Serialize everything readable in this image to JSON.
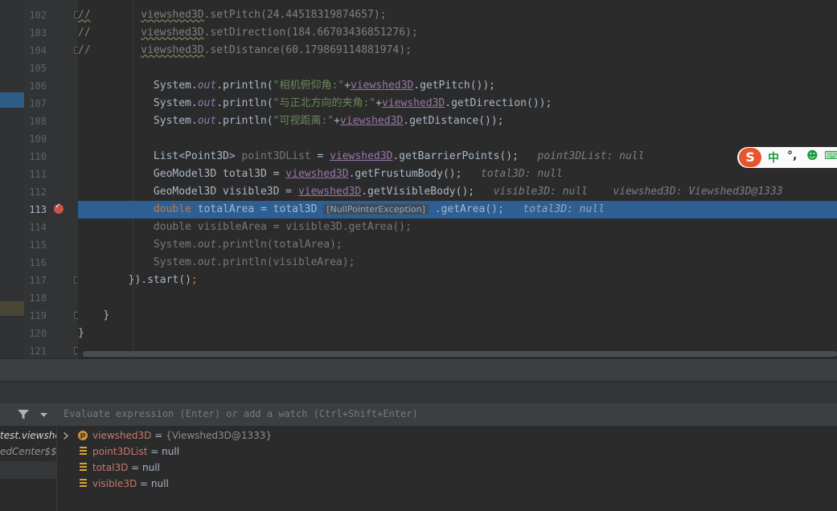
{
  "gutter": {
    "line_numbers": [
      "102",
      "103",
      "104",
      "105",
      "106",
      "107",
      "108",
      "109",
      "110",
      "111",
      "112",
      "113",
      "114",
      "115",
      "116",
      "117",
      "118",
      "119",
      "120",
      "121"
    ],
    "current_line": "113"
  },
  "code": {
    "l102": {
      "comment": "//",
      "obj": "viewshed3D",
      "rest": ".setPitch(24.44518319874657);"
    },
    "l103": {
      "comment": "//",
      "obj": "viewshed3D",
      "rest": ".setDirection(184.66703436851276);"
    },
    "l104": {
      "comment": "//",
      "obj": "viewshed3D",
      "rest": ".setDistance(60.179869114881974);"
    },
    "l106": {
      "a": "System.",
      "out": "out",
      "b": ".println(",
      "str": "\"相机俯仰角:\"",
      "plus": "+",
      "var": "viewshed3D",
      "rest": ".getPitch());"
    },
    "l107": {
      "a": "System.",
      "out": "out",
      "b": ".println(",
      "str": "\"与正北方向的夹角:\"",
      "plus": "+",
      "var": "viewshed3D",
      "rest": ".getDirection());"
    },
    "l108": {
      "a": "System.",
      "out": "out",
      "b": ".println(",
      "str": "\"可视距离:\"",
      "plus": "+",
      "var": "viewshed3D",
      "rest": ".getDistance());"
    },
    "l110": {
      "a": "List<Point3D> ",
      "name": "point3DList",
      "eq": " = ",
      "var": "viewshed3D",
      "rest": ".getBarrierPoints();",
      "inline": "point3DList: null"
    },
    "l111": {
      "a": "GeoModel3D total3D = ",
      "var": "viewshed3D",
      "rest": ".getFrustumBody();",
      "inline": "total3D: null"
    },
    "l112": {
      "a": "GeoModel3D visible3D = ",
      "var": "viewshed3D",
      "rest": ".getVisibleBody();",
      "inline": "visible3D: null",
      "inline2": "viewshed3D: Viewshed3D@1333"
    },
    "l113": {
      "kw": "double",
      "a": " totalArea = total3D",
      "npe": "[NullPointerException]",
      "rest": ".getArea();",
      "inline": "total3D: null"
    },
    "l114": {
      "text": "double visibleArea = visible3D.getArea();"
    },
    "l115": {
      "a": "System.",
      "out": "out",
      "b": ".println(totalArea);"
    },
    "l116": {
      "a": "System.",
      "out": "out",
      "b": ".println(visibleArea);"
    },
    "l117": {
      "a": "}).start()",
      "semi": ";"
    },
    "l119": {
      "text": "}"
    },
    "l120": {
      "text": "}"
    }
  },
  "ime": {
    "logo": "S",
    "lang": "中",
    "punct": "°,",
    "emoji": "☻",
    "keyboard": "⌨"
  },
  "debugger": {
    "eval_placeholder": "Evaluate expression (Enter) or add a watch (Ctrl+Shift+Enter)",
    "frames": [
      "test.viewshe",
      "edCenter$$l"
    ],
    "variables": [
      {
        "name": "viewshed3D",
        "sep": " = ",
        "value": "{Viewshed3D@1333}",
        "kind": "param",
        "expandable": true
      },
      {
        "name": "point3DList",
        "sep": " = ",
        "value": "null",
        "kind": "field"
      },
      {
        "name": "total3D",
        "sep": " = ",
        "value": "null",
        "kind": "field"
      },
      {
        "name": "visible3D",
        "sep": " = ",
        "value": "null",
        "kind": "field"
      }
    ],
    "param_badge": "p"
  },
  "colors": {
    "accent_line": "#2d5f94",
    "keyword": "#cc7832",
    "string": "#6a8759",
    "field": "#9876aa"
  }
}
